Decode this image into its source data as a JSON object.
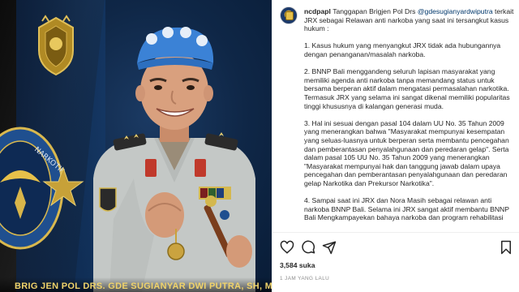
{
  "photo": {
    "caption": "BRIG JEN POL DRS. GDE SUGIANYAR DWI PUTRA, SH, M.SI"
  },
  "post": {
    "username": "ncdpapl",
    "first_line_prefix": "Tanggapan Brigjen Pol Drs ",
    "mention": "@gdesugianyardwiputra",
    "first_line_rest": "terkait JRX sebagai Relawan anti narkoba yang saat ini tersangkut kasus hukum :",
    "points": [
      "1. Kasus hukum yang menyangkut JRX tidak ada hubungannya dengan penanganan/masalah narkoba.",
      "2. BNNP Bali menggandeng seluruh lapisan masyarakat yang memiliki agenda anti narkoba tanpa memandang status untuk bersama berperan aktif dalam mengatasi permasalahan narkotika. Termasuk JRX yang selama ini sangat dikenal memiliki popularitas tinggi khususnya di kalangan generasi muda.",
      "3. Hal ini sesuai dengan pasal 104 dalam UU No. 35 Tahun 2009 yang menerangkan bahwa \"Masyarakat mempunyai kesempatan yang seluas-luasnya untuk berperan serta membantu pencegahan dan pemberantasan penyalahgunaan dan peredaran gelap\". Serta dalam pasal 105 UU No. 35 Tahun 2009 yang menerangkan \"Masyarakat mempunyai hak dan tanggung jawab dalam upaya pencegahan dan pemberantasan penyalahgunaan dan peredaran gelap Narkotika dan Prekursor Narkotika\".",
      "4. Sampai saat ini JRX dan Nora Masih sebagai relawan anti narkoba BNNP Bali. Selama ini JRX sangat aktif membantu BNNP Bali Mengkampayekan bahaya narkoba dan program rehabilitasi"
    ]
  },
  "footer": {
    "likes": "3,584 suka",
    "time": "1 JAM YANG LALU"
  },
  "colors": {
    "text": "#262626",
    "mention": "#00376b",
    "muted": "#8e8e8e",
    "beret": "#3b82d6",
    "uniform": "#c4c8c6"
  },
  "icons": [
    "heart-icon",
    "comment-icon",
    "share-icon",
    "bookmark-icon"
  ]
}
